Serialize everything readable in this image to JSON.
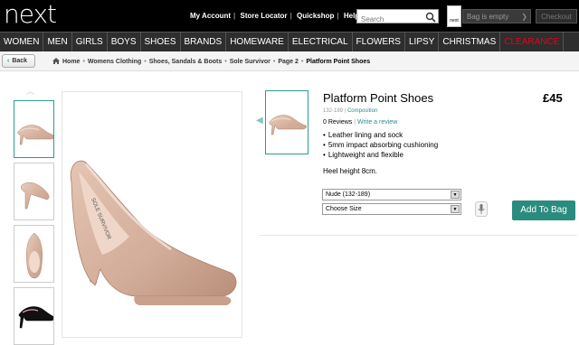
{
  "header": {
    "logo": "next",
    "links": [
      "My Account",
      "Store Locator",
      "Quickshop",
      "Help"
    ],
    "search_placeholder": "Search",
    "bag_icon_label": "next",
    "bag_status": "Bag is empty",
    "checkout": "Checkout"
  },
  "nav": {
    "items": [
      "WOMEN",
      "MEN",
      "GIRLS",
      "BOYS",
      "SHOES",
      "BRANDS",
      "HOMEWARE",
      "ELECTRICAL",
      "FLOWERS",
      "LIPSY",
      "CHRISTMAS",
      "CLEARANCE"
    ]
  },
  "breadcrumb": {
    "back": "Back",
    "items": [
      "Home",
      "Womens Clothing",
      "Shoes, Sandals & Boots",
      "Sole Survivor",
      "Page 2",
      "Platform Point Shoes"
    ]
  },
  "product": {
    "title": "Platform Point Shoes",
    "price": "£45",
    "code": "132-189",
    "composition_link": "Composition",
    "reviews": "0 Reviews",
    "write_review": "Write a review",
    "features": [
      "Leather lining and sock",
      "5mm impact absorbing cushioning",
      "Lightweight and flexible"
    ],
    "heel_height": "Heel height 8cm.",
    "colour_select": "Nude (132-189)",
    "size_select": "Choose Size",
    "add_to_bag": "Add To Bag",
    "insole_text": "SOLE SURVIVOR"
  },
  "colors": {
    "accent": "#2a8c7e",
    "nav_bg": "#2e2e2e",
    "clearance": "#e8001c",
    "shoe": "#d8b8a6"
  }
}
